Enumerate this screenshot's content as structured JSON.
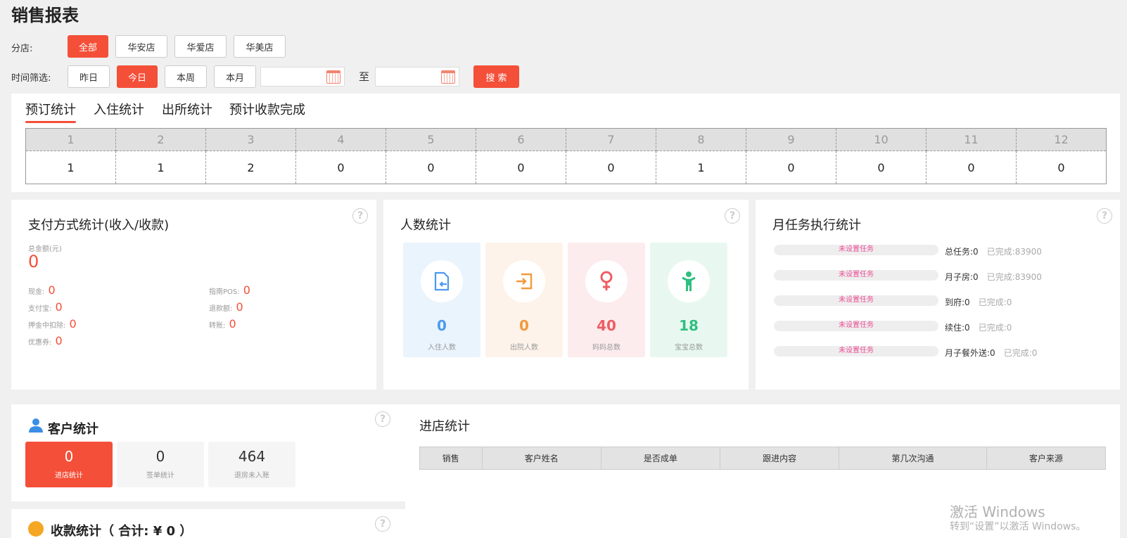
{
  "page": {
    "title": "销售报表"
  },
  "branch": {
    "label": "分店:",
    "options": [
      "全部",
      "华安店",
      "华爱店",
      "华美店"
    ]
  },
  "time": {
    "label": "时间筛选:",
    "options": [
      "昨日",
      "今日",
      "本周",
      "本月"
    ],
    "to": "至",
    "search": "搜 索"
  },
  "tabs": [
    "预订统计",
    "入住统计",
    "出所统计",
    "预计收款完成"
  ],
  "monthly": {
    "headers": [
      "1",
      "2",
      "3",
      "4",
      "5",
      "6",
      "7",
      "8",
      "9",
      "10",
      "11",
      "12"
    ],
    "values": [
      "1",
      "1",
      "2",
      "0",
      "0",
      "0",
      "0",
      "1",
      "0",
      "0",
      "0",
      "0"
    ]
  },
  "payment": {
    "title": "支付方式统计(收入/收款)",
    "total_label": "总金额(元)",
    "total": "0",
    "items": [
      {
        "label": "现金:",
        "value": "0"
      },
      {
        "label": "指南POS:",
        "value": "0"
      },
      {
        "label": "支付宝:",
        "value": "0"
      },
      {
        "label": "退款额:",
        "value": "0"
      },
      {
        "label": "押金中扣除:",
        "value": "0"
      },
      {
        "label": "转账:",
        "value": "0"
      },
      {
        "label": "优惠券:",
        "value": "0"
      }
    ]
  },
  "people": {
    "title": "人数统计",
    "cards": [
      {
        "value": "0",
        "label": "入住人数",
        "icon": "checkin-icon",
        "bg": "#eaf4fd",
        "color": "#4c9aef"
      },
      {
        "value": "0",
        "label": "出院人数",
        "icon": "checkout-icon",
        "bg": "#fdf3ea",
        "color": "#f29a3c"
      },
      {
        "value": "40",
        "label": "妈妈总数",
        "icon": "female-icon",
        "bg": "#fdeced",
        "color": "#ee5d63"
      },
      {
        "value": "18",
        "label": "宝宝总数",
        "icon": "child-icon",
        "bg": "#e8f8f1",
        "color": "#2fbf7f"
      }
    ]
  },
  "tasks": {
    "title": "月任务执行统计",
    "rows": [
      {
        "bar": "未设置任务",
        "name": "总任务:0",
        "done": "已完成:83900"
      },
      {
        "bar": "未设置任务",
        "name": "月子房:0",
        "done": "已完成:83900"
      },
      {
        "bar": "未设置任务",
        "name": "到府:0",
        "done": "已完成:0"
      },
      {
        "bar": "未设置任务",
        "name": "续住:0",
        "done": "已完成:0"
      },
      {
        "bar": "未设置任务",
        "name": "月子餐外送:0",
        "done": "已完成:0"
      }
    ]
  },
  "customer": {
    "title": "客户统计",
    "boxes": [
      {
        "value": "0",
        "label": "进店统计"
      },
      {
        "value": "0",
        "label": "签单统计"
      },
      {
        "value": "464",
        "label": "退房未入账"
      }
    ]
  },
  "collection": {
    "title": "收款统计（ 合计: ¥ 0 ）"
  },
  "store": {
    "title": "进店统计",
    "columns": [
      "销售",
      "客户姓名",
      "是否成单",
      "跟进内容",
      "第几次沟通",
      "客户来源"
    ]
  },
  "watermark": {
    "line1": "激活 Windows",
    "line2": "转到“设置”以激活 Windows。"
  },
  "colors": {
    "accent": "#f44f38",
    "task_bar_text": "#ec4c94"
  }
}
